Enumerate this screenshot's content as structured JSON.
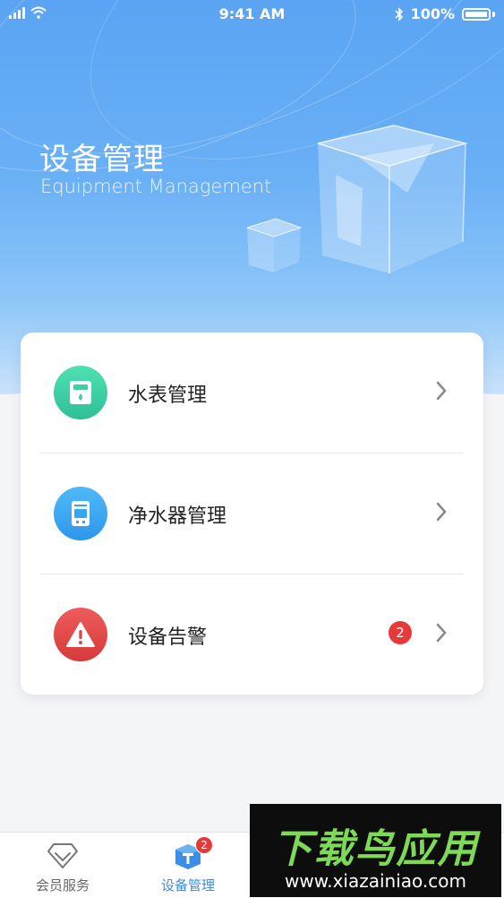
{
  "status_bar": {
    "time": "9:41 AM",
    "battery": "100%"
  },
  "header": {
    "title": "设备管理",
    "subtitle": "Equipment Management"
  },
  "menu": {
    "items": [
      {
        "label": "水表管理",
        "icon": "water-meter-icon",
        "color": "#3ed0a4"
      },
      {
        "label": "净水器管理",
        "icon": "water-purifier-icon",
        "color": "#35a6f2"
      },
      {
        "label": "设备告警",
        "icon": "warning-icon",
        "color": "#e24b4b",
        "badge": "2"
      }
    ]
  },
  "tabbar": {
    "tabs": [
      {
        "label": "会员服务",
        "icon": "diamond-icon"
      },
      {
        "label": "设备管理",
        "icon": "device-cube-icon",
        "badge": "2",
        "active": true
      }
    ]
  },
  "watermark": {
    "text": "下载鸟应用",
    "url": "www.xiazainiao.com"
  }
}
